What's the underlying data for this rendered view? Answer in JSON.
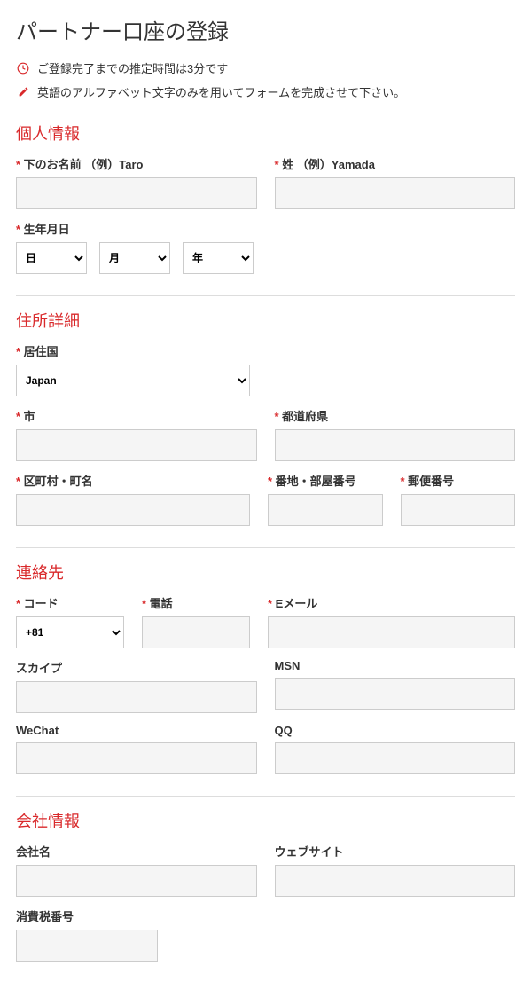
{
  "title": "パートナー口座の登録",
  "info1": "ご登録完了までの推定時間は3分です",
  "info2_pre": "英語のアルファベット文字",
  "info2_underline": "のみ",
  "info2_post": "を用いてフォームを完成させて下さい。",
  "section1": {
    "heading": "個人情報",
    "firstName": "下のお名前 （例）Taro",
    "lastName": "姓 （例）Yamada",
    "dob": "生年月日",
    "day": "日",
    "month": "月",
    "year": "年"
  },
  "section2": {
    "heading": "住所詳細",
    "country": "居住国",
    "countryValue": "Japan",
    "city": "市",
    "prefecture": "都道府県",
    "district": "区町村・町名",
    "address": "番地・部屋番号",
    "postal": "郵便番号"
  },
  "section3": {
    "heading": "連絡先",
    "code": "コード",
    "codeValue": "+81",
    "phone": "電話",
    "email": "Eメール",
    "skype": "スカイプ",
    "msn": "MSN",
    "wechat": "WeChat",
    "qq": "QQ"
  },
  "section4": {
    "heading": "会社情報",
    "company": "会社名",
    "website": "ウェブサイト",
    "tax": "消費税番号"
  }
}
